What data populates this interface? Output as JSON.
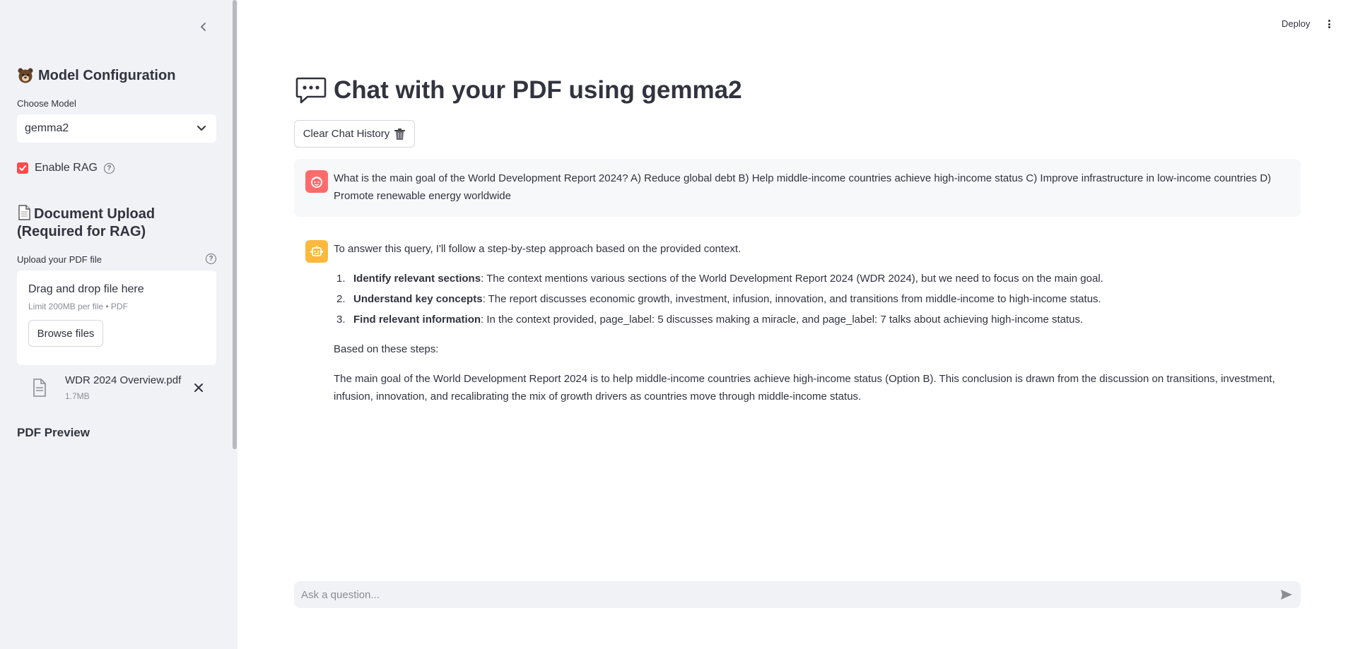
{
  "sidebar": {
    "model_heading": "Model Configuration",
    "choose_model_label": "Choose Model",
    "selected_model": "gemma2",
    "enable_rag_label": "Enable RAG",
    "enable_rag_checked": true,
    "doc_heading": "Document Upload (Required for RAG)",
    "upload_label": "Upload your PDF file",
    "dropzone_title": "Drag and drop file here",
    "dropzone_limit": "Limit 200MB per file • PDF",
    "browse_label": "Browse files",
    "uploaded_file": {
      "name": "WDR 2024 Overview.pdf",
      "size": "1.7MB"
    },
    "pdf_preview_heading": "PDF Preview"
  },
  "header": {
    "deploy_label": "Deploy"
  },
  "main": {
    "title": "Chat with your PDF using gemma2",
    "clear_label": "Clear Chat History",
    "user_message": "What is the main goal of the World Development Report 2024? A) Reduce global debt B) Help middle-income countries achieve high-income status C) Improve infrastructure in low-income countries D) Promote renewable energy worldwide",
    "assistant": {
      "intro": "To answer this query, I'll follow a step-by-step approach based on the provided context.",
      "steps": [
        {
          "num": "1.",
          "bold": "Identify relevant sections",
          "text": ": The context mentions various sections of the World Development Report 2024 (WDR 2024), but we need to focus on the main goal."
        },
        {
          "num": "2.",
          "bold": "Understand key concepts",
          "text": ": The report discusses economic growth, investment, infusion, innovation, and transitions from middle-income to high-income status."
        },
        {
          "num": "3.",
          "bold": "Find relevant information",
          "text": ": In the context provided, page_label: 5 discusses making a miracle, and page_label: 7 talks about achieving high-income status."
        }
      ],
      "based_on": "Based on these steps:",
      "conclusion": "The main goal of the World Development Report 2024 is to help middle-income countries achieve high-income status (Option B). This conclusion is drawn from the discussion on transitions, investment, infusion, innovation, and recalibrating the mix of growth drivers as countries move through middle-income status."
    },
    "input_placeholder": "Ask a question..."
  },
  "colors": {
    "sidebar_bg": "#f0f2f6",
    "accent": "#ff4b4b",
    "user_avatar": "#ff6b6b",
    "bot_avatar": "#fdb93b"
  },
  "icons": [
    "chevron-left-icon",
    "bear-icon",
    "chevron-down-icon",
    "help-icon",
    "document-icon",
    "file-icon",
    "close-icon",
    "speech-bubble-icon",
    "trash-icon",
    "user-face-icon",
    "robot-icon",
    "send-icon",
    "kebab-menu-icon"
  ]
}
